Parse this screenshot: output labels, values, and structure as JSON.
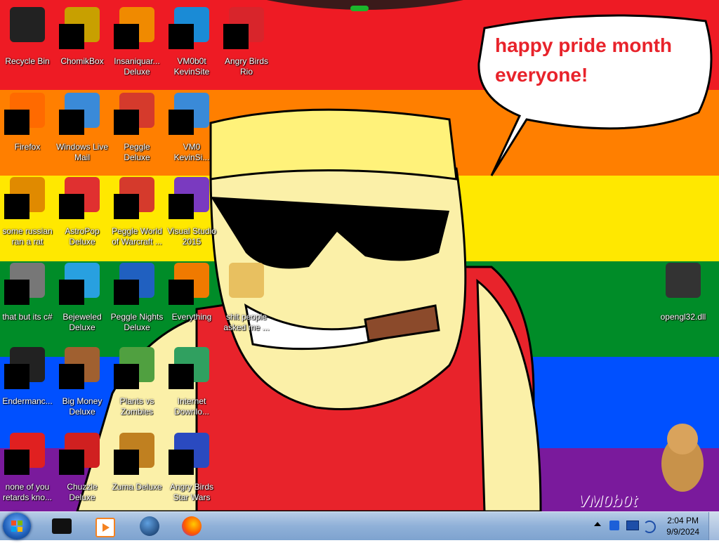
{
  "colors": {
    "stripes": [
      "#ee1b24",
      "#ff7f00",
      "#ffe800",
      "#008c28",
      "#0050ff",
      "#7a1a9c"
    ],
    "cap": "#fff27a",
    "skin": "#fbf0a8",
    "shirt": "#e8232b"
  },
  "speech_bubble": {
    "line1": "happy pride month",
    "line2": "everyone!"
  },
  "watermark": "VM0b0t",
  "desktop_icons": [
    {
      "label": "Recycle Bin",
      "icon": "recycle-bin-icon"
    },
    {
      "label": "ChomikBox",
      "icon": "chomikbox-icon"
    },
    {
      "label": "Insaniquar... Deluxe",
      "icon": "insaniquarium-icon"
    },
    {
      "label": "VM0b0t KevinSite",
      "icon": "vm0b0t-kevinsite-icon"
    },
    {
      "label": "Angry Birds Rio",
      "icon": "angry-birds-rio-icon"
    },
    {
      "label": "Firefox",
      "icon": "firefox-icon"
    },
    {
      "label": "Windows Live Mail",
      "icon": "windows-live-mail-icon"
    },
    {
      "label": "Peggle Deluxe",
      "icon": "peggle-deluxe-icon"
    },
    {
      "label": "VM0 KevinSi...",
      "icon": "vm0-kevinsite-icon"
    },
    {
      "label": "some russian ran a rat",
      "icon": "pe-app-icon"
    },
    {
      "label": "AstroPop Deluxe",
      "icon": "astropop-icon"
    },
    {
      "label": "Peggle World of Warcraft ...",
      "icon": "peggle-wow-icon"
    },
    {
      "label": "Visual Studio 2015",
      "icon": "visual-studio-icon"
    },
    {
      "label": "that but its c#",
      "icon": "stacked-windows-icon"
    },
    {
      "label": "Bejeweled Deluxe",
      "icon": "bejeweled-icon"
    },
    {
      "label": "Peggle Nights Deluxe",
      "icon": "peggle-nights-icon"
    },
    {
      "label": "Everything",
      "icon": "everything-search-icon"
    },
    {
      "label": "shit people asked me ...",
      "icon": "folder-icon"
    },
    {
      "label": "opengl32.dll",
      "icon": "dll-file-icon"
    },
    {
      "label": "Endermanc...",
      "icon": "terminal-icon"
    },
    {
      "label": "Big Money Deluxe",
      "icon": "big-money-icon"
    },
    {
      "label": "Plants vs Zombies",
      "icon": "plants-vs-zombies-icon"
    },
    {
      "label": "Internet Downlo...",
      "icon": "internet-download-manager-icon"
    },
    {
      "label": "none of you retards kno...",
      "icon": "red-circle-app-icon"
    },
    {
      "label": "Chuzzle Deluxe",
      "icon": "chuzzle-icon"
    },
    {
      "label": "Zuma Deluxe",
      "icon": "zuma-icon"
    },
    {
      "label": "Angry Birds Star Wars",
      "icon": "angry-birds-star-wars-icon"
    }
  ],
  "taskbar": {
    "pinned": [
      {
        "name": "pinned-app-black-box",
        "icon": "black-box-icon"
      },
      {
        "name": "pinned-media-player",
        "icon": "media-player-icon"
      },
      {
        "name": "pinned-globe",
        "icon": "globe-icon"
      },
      {
        "name": "pinned-firefox",
        "icon": "firefox-icon"
      }
    ],
    "clock_time": "2:04 PM",
    "clock_date": "9/9/2024"
  }
}
